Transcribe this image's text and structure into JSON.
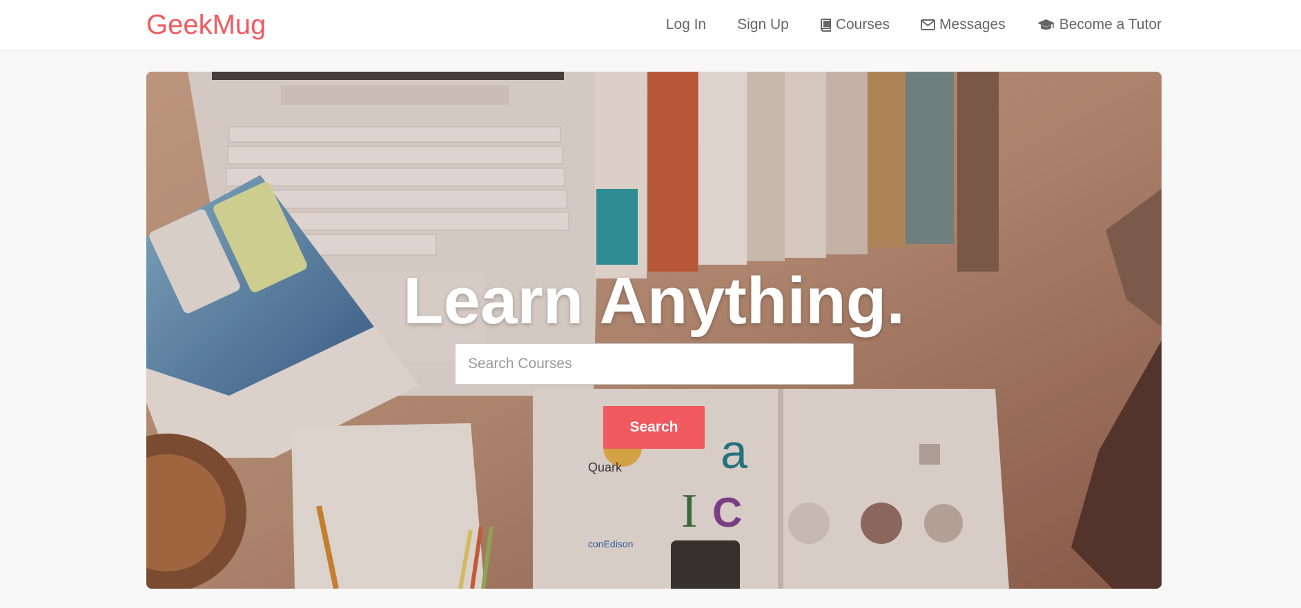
{
  "brand": {
    "name": "GeekMug",
    "color": "#f05a5f"
  },
  "nav": {
    "login": "Log In",
    "signup": "Sign Up",
    "courses": "Courses",
    "messages": "Messages",
    "tutor": "Become a Tutor",
    "icons": {
      "courses": "book-icon",
      "messages": "envelope-icon",
      "tutor": "graduation-cap-icon"
    }
  },
  "hero": {
    "title": "Learn Anything.",
    "search_placeholder": "Search Courses",
    "search_value": "",
    "search_button": "Search",
    "accent": "#f05a5f"
  }
}
